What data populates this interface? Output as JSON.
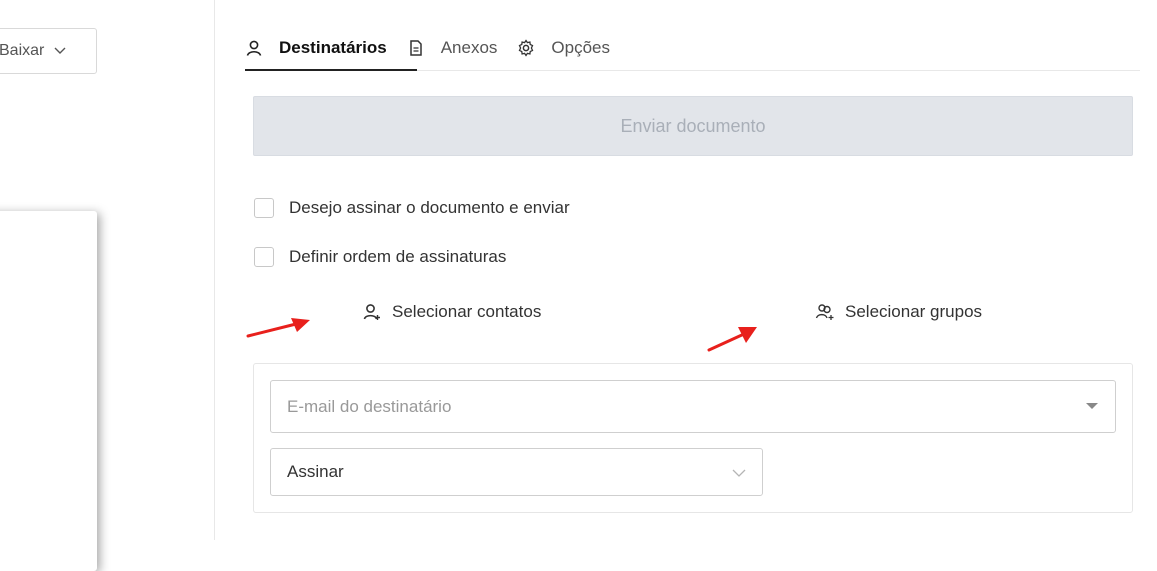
{
  "left_pane": {
    "download_label": "Baixar"
  },
  "tabs": [
    {
      "label": "Destinatários",
      "icon": "user-icon",
      "active": true
    },
    {
      "label": "Anexos",
      "icon": "document-icon",
      "active": false
    },
    {
      "label": "Opções",
      "icon": "gear-icon",
      "active": false
    }
  ],
  "send_button": {
    "label": "Enviar documento",
    "disabled": true
  },
  "options": {
    "sign_and_send": {
      "label": "Desejo assinar o documento e enviar",
      "checked": false
    },
    "signature_order": {
      "label": "Definir ordem de assinaturas",
      "checked": false
    }
  },
  "links": {
    "select_contacts": {
      "label": "Selecionar contatos",
      "icon": "user-add-icon"
    },
    "select_groups": {
      "label": "Selecionar grupos",
      "icon": "users-add-icon"
    }
  },
  "recipient": {
    "email_placeholder": "E-mail do destinatário",
    "action_value": "Assinar"
  },
  "colors": {
    "annotation_arrow": "#e8201c",
    "disabled_button_bg": "#e2e5ea",
    "disabled_button_text": "#a9afb8"
  }
}
